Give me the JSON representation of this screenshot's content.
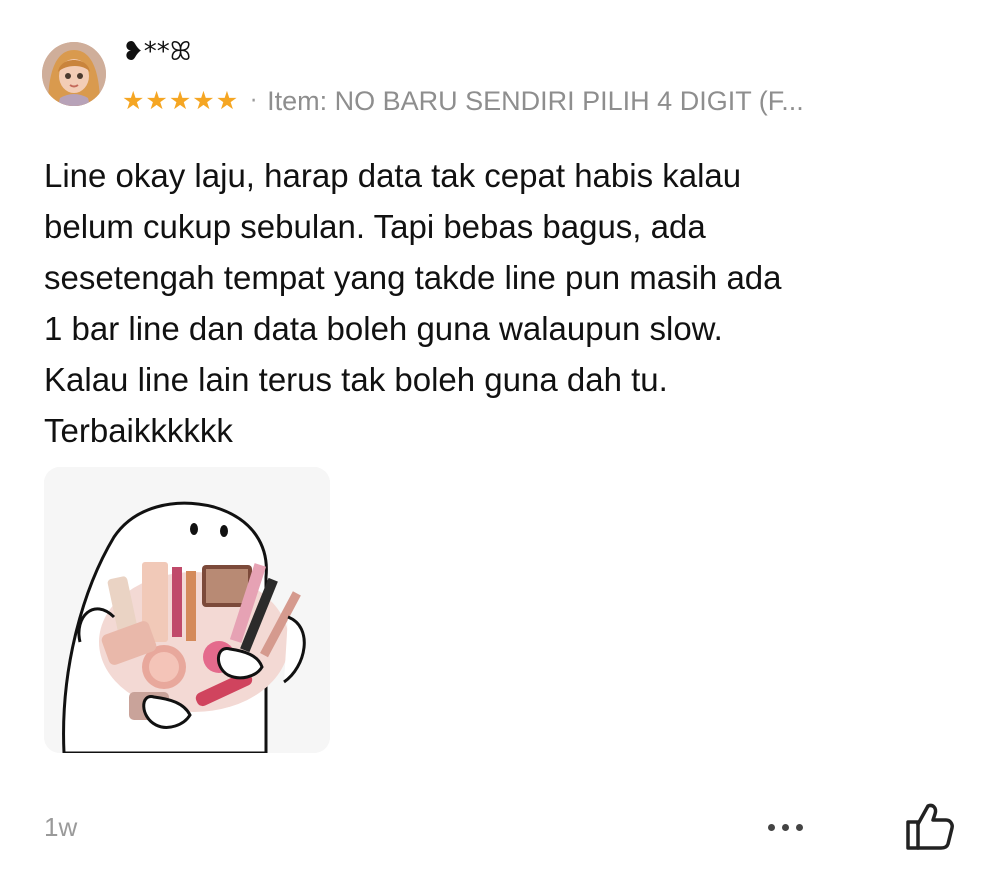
{
  "review": {
    "username": "❥**ꕤ",
    "avatar_icon": "user-avatar",
    "rating": 5,
    "stars": [
      "★",
      "★",
      "★",
      "★",
      "★"
    ],
    "item_separator": "·",
    "item_label": "Item: NO BARU SENDIRI PILIH 4 DIGIT (F...",
    "text": "Line okay laju, harap data tak cepat habis kalau\nbelum cukup sebulan. Tapi bebas bagus, ada\nsesetengah tempat yang takde line pun masih ada\n1 bar line dan data boleh guna walaupun slow.\nKalau line lain terus tak boleh guna dah tu.\nTerbaikkkkkk",
    "photo_icon": "review-photo-sticker",
    "timestamp": "1w"
  },
  "actions": {
    "more_icon": "more-dots-icon",
    "like_icon": "thumbs-up-icon"
  },
  "colors": {
    "star": "#f5a623",
    "text": "#111111",
    "muted": "#8e8e8e",
    "background": "#ffffff"
  }
}
